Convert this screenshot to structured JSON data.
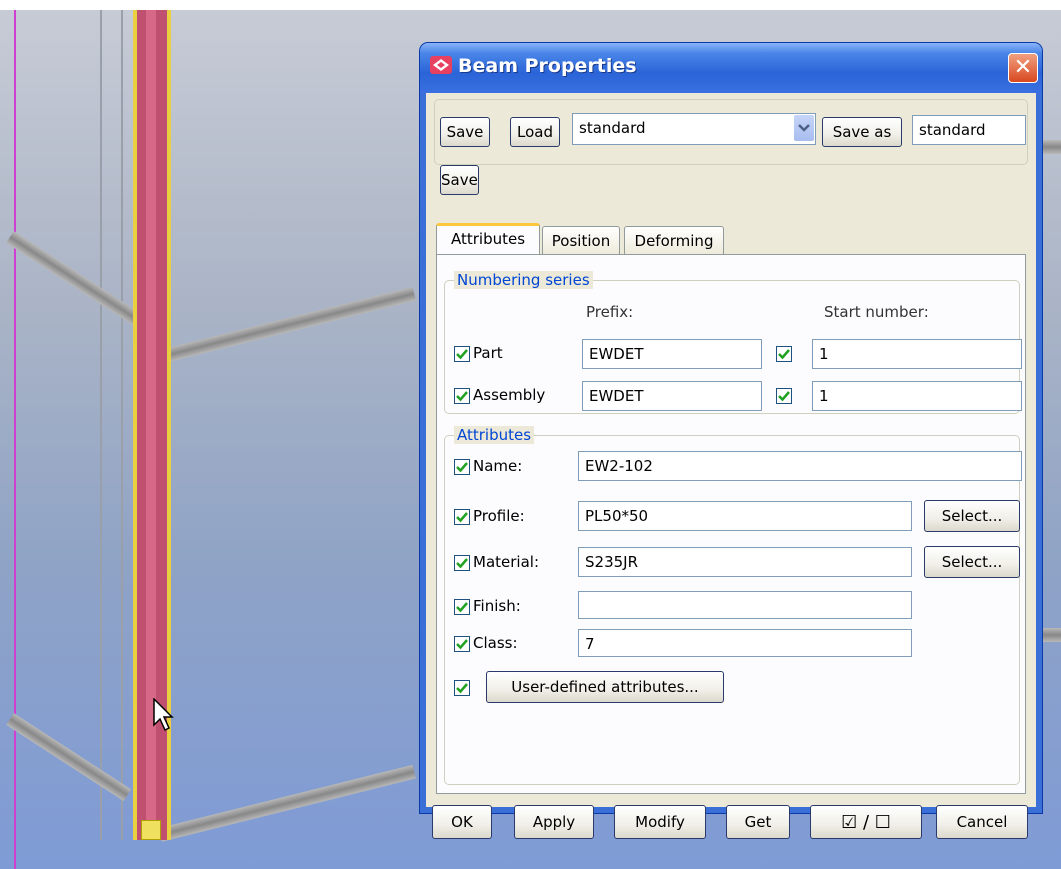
{
  "dialog": {
    "title": "Beam Properties",
    "close_label": "✕"
  },
  "toolbar": {
    "save_label": "Save",
    "load_label": "Load",
    "preset_value": "standard",
    "save_as_label": "Save as",
    "save_as_value": "standard"
  },
  "tabs": [
    {
      "label": "Attributes"
    },
    {
      "label": "Position"
    },
    {
      "label": "Deforming"
    }
  ],
  "numbering": {
    "group_label": "Numbering series",
    "prefix_header": "Prefix:",
    "start_header": "Start number:",
    "rows": [
      {
        "label": "Part",
        "prefix": "EWDET",
        "start": "1"
      },
      {
        "label": "Assembly",
        "prefix": "EWDET",
        "start": "1"
      }
    ]
  },
  "attributes": {
    "group_label": "Attributes",
    "name_label": "Name:",
    "name_value": "EW2-102",
    "profile_label": "Profile:",
    "profile_value": "PL50*50",
    "material_label": "Material:",
    "material_value": "S235JR",
    "finish_label": "Finish:",
    "finish_value": "",
    "class_label": "Class:",
    "class_value": "7",
    "select_label": "Select...",
    "user_defined_label": "User-defined attributes..."
  },
  "footer": {
    "ok_label": "OK",
    "apply_label": "Apply",
    "modify_label": "Modify",
    "get_label": "Get",
    "toggle_label": "☑ / ☐",
    "cancel_label": "Cancel"
  },
  "colors": {
    "title_bar": "#2a64d8",
    "dialog_bg": "#ece9d8",
    "group_label": "#0046d5",
    "column": "#c05070",
    "column_outline": "#e8d040"
  }
}
